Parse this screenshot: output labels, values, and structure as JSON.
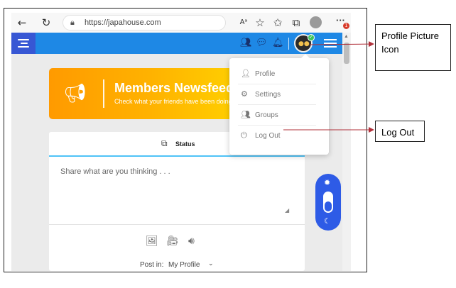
{
  "browser": {
    "url": "https://japahouse.com",
    "notification_count": "1",
    "icons": [
      "back-arrow-icon",
      "refresh-icon",
      "lock-icon",
      "read-aloud-icon",
      "favorite-star-icon",
      "favorites-icon",
      "collections-icon",
      "account-avatar-icon",
      "more-dots-icon"
    ]
  },
  "header": {
    "icons": [
      "friends-icon",
      "chat-icon",
      "notifications-bell-icon"
    ]
  },
  "banner": {
    "title": "Members Newsfeed",
    "subtitle": "Check what your friends have been doing"
  },
  "dropdown": {
    "items": [
      {
        "label": "Profile",
        "icon": "user-icon"
      },
      {
        "label": "Settings",
        "icon": "gear-icon"
      },
      {
        "label": "Groups",
        "icon": "group-icon"
      },
      {
        "label": "Log Out",
        "icon": "power-icon"
      }
    ]
  },
  "composer": {
    "tab_label": "Status",
    "placeholder": "Share what are you thinking . . .",
    "post_in_label": "Post in:",
    "post_in_value": "My Profile"
  },
  "annotations": {
    "profile_picture": "Profile Picture Icon",
    "log_out": "Log Out"
  },
  "colors": {
    "header_blue": "#1e88e5",
    "menu_tile": "#3757d4",
    "banner_orange": "#ff9a00",
    "toggle_blue": "#2e5be6",
    "tab_underline": "#4fc3f7"
  }
}
